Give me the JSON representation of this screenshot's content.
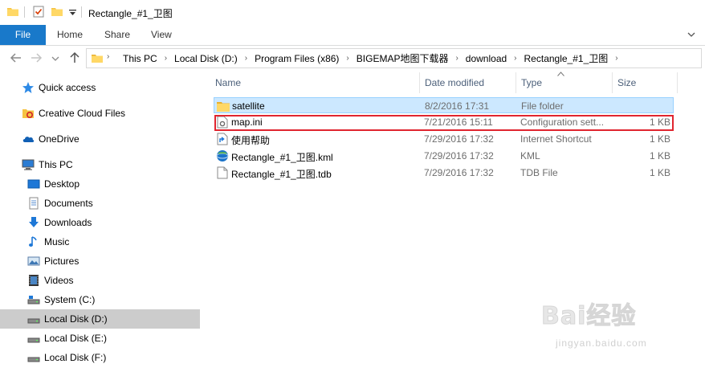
{
  "window": {
    "title": "Rectangle_#1_卫图"
  },
  "ribbon": {
    "tabs": [
      "File",
      "Home",
      "Share",
      "View"
    ]
  },
  "address": {
    "crumbs": [
      "This PC",
      "Local Disk (D:)",
      "Program Files (x86)",
      "BIGEMAP地图下载器",
      "download",
      "Rectangle_#1_卫图"
    ]
  },
  "nav": {
    "items": [
      {
        "label": "Quick access",
        "icon": "star-icon"
      },
      {
        "label": "Creative Cloud Files",
        "icon": "creative-cloud-icon"
      },
      {
        "label": "OneDrive",
        "icon": "cloud-icon"
      },
      {
        "label": "This PC",
        "icon": "computer-icon"
      },
      {
        "label": "Desktop",
        "icon": "desktop-icon"
      },
      {
        "label": "Documents",
        "icon": "documents-icon"
      },
      {
        "label": "Downloads",
        "icon": "downloads-icon"
      },
      {
        "label": "Music",
        "icon": "music-icon"
      },
      {
        "label": "Pictures",
        "icon": "pictures-icon"
      },
      {
        "label": "Videos",
        "icon": "videos-icon"
      },
      {
        "label": "System (C:)",
        "icon": "system-drive-icon"
      },
      {
        "label": "Local Disk (D:)",
        "icon": "drive-icon",
        "selected": true
      },
      {
        "label": "Local Disk (E:)",
        "icon": "drive-icon"
      },
      {
        "label": "Local Disk (F:)",
        "icon": "drive-icon"
      }
    ]
  },
  "filelist": {
    "columns": {
      "name": "Name",
      "date": "Date modified",
      "type": "Type",
      "size": "Size"
    },
    "files": [
      {
        "name": "satellite",
        "date": "8/2/2016 17:31",
        "type": "File folder",
        "size": "",
        "icon": "folder-icon"
      },
      {
        "name": "map.ini",
        "date": "7/21/2016 15:11",
        "type": "Configuration sett...",
        "size": "1 KB",
        "icon": "ini-file-icon"
      },
      {
        "name": "使用帮助",
        "date": "7/29/2016 17:32",
        "type": "Internet Shortcut",
        "size": "1 KB",
        "icon": "internet-shortcut-icon"
      },
      {
        "name": "Rectangle_#1_卫图.kml",
        "date": "7/29/2016 17:32",
        "type": "KML",
        "size": "1 KB",
        "icon": "kml-file-icon"
      },
      {
        "name": "Rectangle_#1_卫图.tdb",
        "date": "7/29/2016 17:32",
        "type": "TDB File",
        "size": "1 KB",
        "icon": "blank-file-icon"
      }
    ]
  },
  "watermark": {
    "logo": "Bai经验",
    "url": "jingyan.baidu.com"
  },
  "colors": {
    "accent": "#1979ca",
    "selection": "#cce8ff",
    "highlight": "#e0252f"
  }
}
